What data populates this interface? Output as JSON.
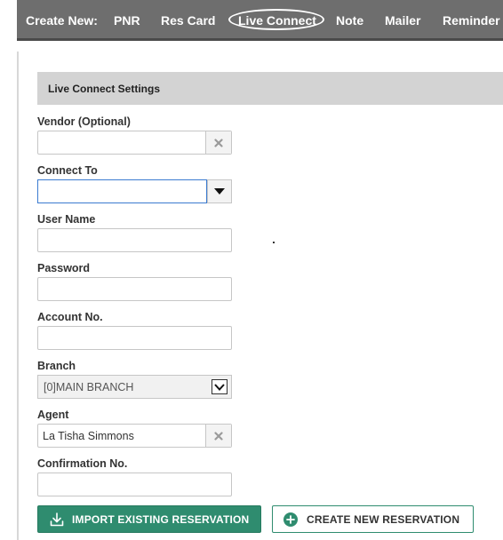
{
  "nav": {
    "label": "Create New:",
    "items": [
      {
        "label": "PNR"
      },
      {
        "label": "Res Card"
      },
      {
        "label": "Live Connect",
        "selected": true
      },
      {
        "label": "Note"
      },
      {
        "label": "Mailer"
      },
      {
        "label": "Reminder"
      }
    ]
  },
  "section": {
    "title": "Live Connect Settings"
  },
  "form": {
    "vendor": {
      "label": "Vendor (Optional)",
      "value": ""
    },
    "connect_to": {
      "label": "Connect To",
      "value": ""
    },
    "user_name": {
      "label": "User Name",
      "value": ""
    },
    "password": {
      "label": "Password",
      "value": ""
    },
    "account_no": {
      "label": "Account No.",
      "value": ""
    },
    "branch": {
      "label": "Branch",
      "value": "[0]MAIN BRANCH"
    },
    "agent": {
      "label": "Agent",
      "value": "La Tisha Simmons"
    },
    "confirmation_no": {
      "label": "Confirmation No.",
      "value": ""
    }
  },
  "actions": {
    "import_label": "IMPORT EXISTING RESERVATION",
    "create_label": "CREATE NEW RESERVATION"
  },
  "colors": {
    "nav_bg": "#6e6e6e",
    "section_bg": "#d3d3d3",
    "accent_green": "#2f8c6f",
    "focus_blue": "#3b7bd0"
  },
  "icons": {
    "clear": "x-icon",
    "dropdown": "caret-down-icon",
    "select": "chevron-down-icon",
    "import": "download-icon",
    "create": "plus-circle-icon"
  }
}
